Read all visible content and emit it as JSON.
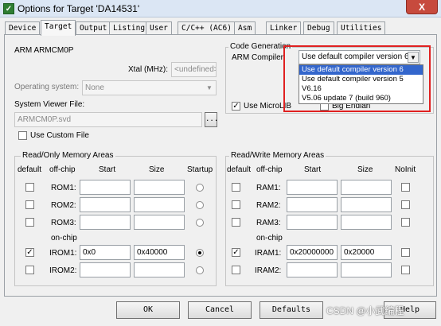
{
  "window": {
    "title": "Options for Target 'DA14531'",
    "close_glyph": "X"
  },
  "tabs": [
    "Device",
    "Target",
    "Output",
    "Listing",
    "User",
    "C/C++ (AC6)",
    "Asm",
    "Linker",
    "Debug",
    "Utilities"
  ],
  "active_tab": "Target",
  "device": {
    "name": "ARM ARMCM0P"
  },
  "xtal": {
    "label": "Xtal (MHz):",
    "value": "<undefined>"
  },
  "os": {
    "label": "Operating system:",
    "value": "None"
  },
  "svd": {
    "label": "System Viewer File:",
    "value": "ARMCM0P.svd",
    "browse": "..."
  },
  "use_custom_file": {
    "label": "Use Custom File",
    "checked": false
  },
  "code_generation": {
    "title": "Code Generation",
    "compiler_label": "ARM Compiler:",
    "compiler_value": "Use default compiler version 6",
    "options": [
      "Use default compiler version 6",
      "Use default compiler version 5",
      "V6.16",
      "V5.06 update 7 (build 960)"
    ],
    "use_microlib": {
      "label": "Use MicroLIB",
      "checked": true
    },
    "big_endian": {
      "label": "Big Endian",
      "checked": false
    }
  },
  "ro_memory": {
    "title": "Read/Only Memory Areas",
    "headers": {
      "default": "default",
      "offchip": "off-chip",
      "start": "Start",
      "size": "Size",
      "startup": "Startup"
    },
    "onchip_label": "on-chip",
    "rows": [
      {
        "name": "ROM1:",
        "start": "",
        "size": "",
        "default": false,
        "startup": false
      },
      {
        "name": "ROM2:",
        "start": "",
        "size": "",
        "default": false,
        "startup": false
      },
      {
        "name": "ROM3:",
        "start": "",
        "size": "",
        "default": false,
        "startup": false
      },
      {
        "name": "IROM1:",
        "start": "0x0",
        "size": "0x40000",
        "default": true,
        "startup": true
      },
      {
        "name": "IROM2:",
        "start": "",
        "size": "",
        "default": false,
        "startup": false
      }
    ]
  },
  "rw_memory": {
    "title": "Read/Write Memory Areas",
    "headers": {
      "default": "default",
      "offchip": "off-chip",
      "start": "Start",
      "size": "Size",
      "noinit": "NoInit"
    },
    "onchip_label": "on-chip",
    "rows": [
      {
        "name": "RAM1:",
        "start": "",
        "size": "",
        "default": false,
        "noinit": false
      },
      {
        "name": "RAM2:",
        "start": "",
        "size": "",
        "default": false,
        "noinit": false
      },
      {
        "name": "RAM3:",
        "start": "",
        "size": "",
        "default": false,
        "noinit": false
      },
      {
        "name": "IRAM1:",
        "start": "0x20000000",
        "size": "0x20000",
        "default": true,
        "noinit": false
      },
      {
        "name": "IRAM2:",
        "start": "",
        "size": "",
        "default": false,
        "noinit": false
      }
    ]
  },
  "buttons": {
    "ok": "OK",
    "cancel": "Cancel",
    "defaults": "Defaults",
    "help": "Help"
  },
  "watermark": "CSDN @小武编程",
  "colors": {
    "highlight": "#3366cc",
    "annotation": "#e02020",
    "close": "#c74a3d"
  }
}
